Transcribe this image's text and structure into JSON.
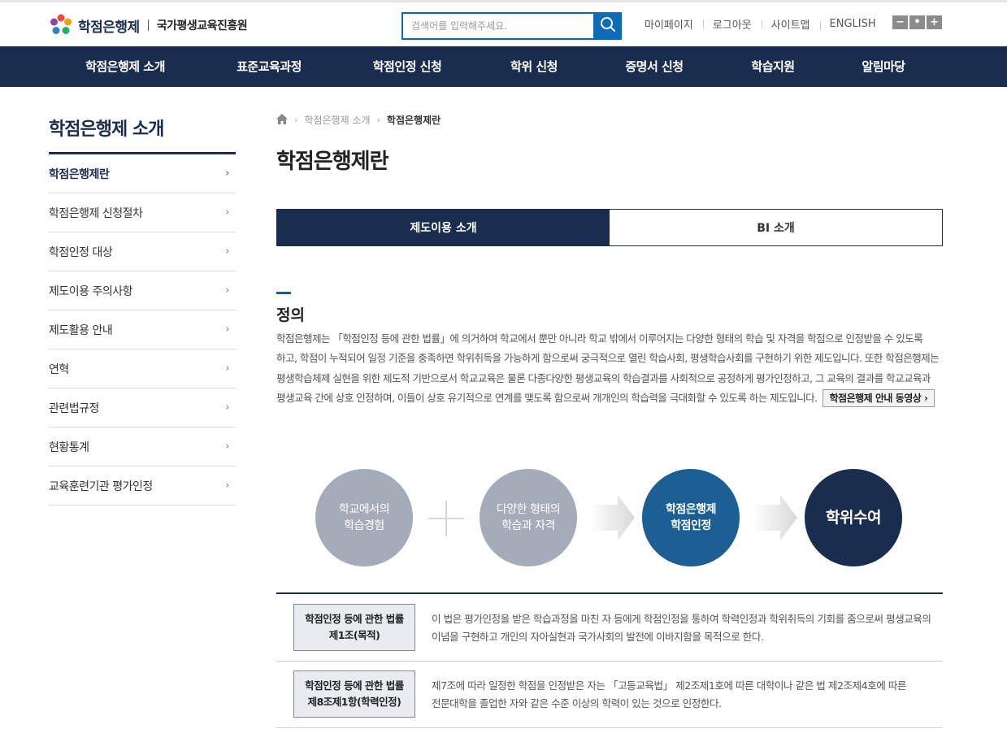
{
  "header": {
    "logo_name": "학점은행제",
    "logo_org": "국가평생교육진흥원",
    "search_placeholder": "검색어를 입력해주세요.",
    "util_links": [
      "마이페이지",
      "로그아웃",
      "사이트맵",
      "ENGLISH"
    ],
    "zoom_buttons": [
      "−",
      "•",
      "+"
    ]
  },
  "gnb": [
    "학점은행제 소개",
    "표준교육과정",
    "학점인정 신청",
    "학위 신청",
    "증명서 신청",
    "학습지원",
    "알림마당"
  ],
  "sidebar": {
    "title": "학점은행제 소개",
    "items": [
      {
        "label": "학점은행제란",
        "active": true
      },
      {
        "label": "학점은행제 신청절차",
        "active": false
      },
      {
        "label": "학점인정 대상",
        "active": false
      },
      {
        "label": "제도이용 주의사항",
        "active": false
      },
      {
        "label": "제도활용 안내",
        "active": false
      },
      {
        "label": "연혁",
        "active": false
      },
      {
        "label": "관련법규정",
        "active": false
      },
      {
        "label": "현황통계",
        "active": false
      },
      {
        "label": "교육훈련기관 평가인정",
        "active": false
      }
    ]
  },
  "breadcrumb": [
    "학점은행제 소개",
    "학점은행제란"
  ],
  "page_title": "학점은행제란",
  "tabs": [
    {
      "label": "제도이용 소개",
      "active": true
    },
    {
      "label": "BI 소개",
      "active": false
    }
  ],
  "definition": {
    "title": "정의",
    "text": "학점은행제는 「학점인정 등에 관한 법률」에 의거하여 학교에서 뿐만 아니라 학교 밖에서 이루어지는 다양한 형태의 학습 및 자격을 학점으로 인정받을 수 있도록 하고, 학점이 누적되어 일정 기준을 충족하면 학위취득을 가능하게 함으로써 궁극적으로 열린 학습사회, 평생학습사회를 구현하기 위한 제도입니다. 또한 학점은행제는 평생학습체제 실현을 위한 제도적 기반으로서 학교교육은 물론 다종다양한 평생교육의 학습결과를 사회적으로 공정하게 평가인정하고, 그 교육의 결과를 학교교육과 평생교육 간에 상호 인정하며, 이들이 상호 유기적으로 연계를 맺도록 함으로써 개개인의 학습력을 극대화할 수 있도록 하는 제도입니다.",
    "video_button": "학점은행제 안내 동영상"
  },
  "diagram": {
    "steps": [
      {
        "line1": "학교에서의",
        "line2": "학습경험"
      },
      {
        "line1": "다양한 형태의",
        "line2": "학습과 자격"
      },
      {
        "line1": "학점은행제",
        "line2": "학점인정"
      },
      {
        "line1": "학위수여",
        "line2": ""
      }
    ]
  },
  "laws": [
    {
      "name_line1": "학점인정 등에 관한 법률",
      "name_line2": "제1조(목적)",
      "desc": "이 법은 평가인정을 받은 학습과정을 마친 자 등에게 학점인정을 통하여 학력인정과 학위취득의 기회를 줌으로써 평생교육의 이념을 구현하고 개인의 자아실현과 국가사회의 발전에 이바지함을 목적으로 한다."
    },
    {
      "name_line1": "학점인정 등에 관한 법률",
      "name_line2": "제8조제1항(학력인정)",
      "desc": "제7조에 따라 일정한 학점을 인정받은 자는 「고등교육법」 제2조제1호에 따른 대학이나 같은 법 제2조제4호에 따른 전문대학을 졸업한 자와 같은 수준 이상의 학력이 있는 것으로 인정한다."
    }
  ],
  "colors": {
    "navy": "#1b2d4f",
    "blue": "#0f6bb5",
    "mid_blue": "#1c5f95",
    "gray_circle": "#a4acb9"
  }
}
